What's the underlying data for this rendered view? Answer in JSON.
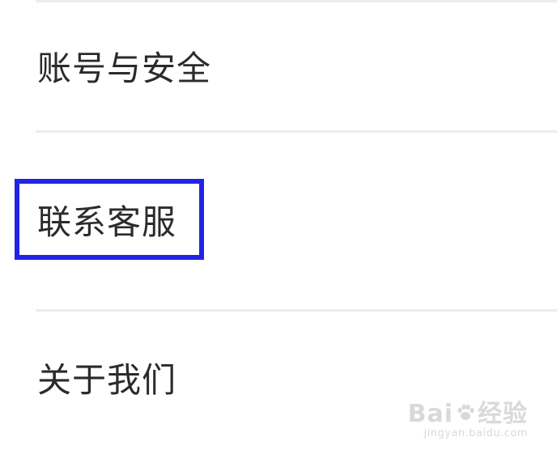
{
  "menu": {
    "items": [
      {
        "label": "账号与安全"
      },
      {
        "label": "联系客服"
      },
      {
        "label": "关于我们"
      }
    ]
  },
  "watermark": {
    "logo_left": "Bai",
    "logo_right": "经验",
    "url": "jingyan.baidu.com",
    "icon": "paw-icon"
  },
  "colors": {
    "highlight_border": "#2323e6",
    "divider": "#ececec",
    "text": "#2b2b2b",
    "watermark": "#d9d9d9"
  }
}
